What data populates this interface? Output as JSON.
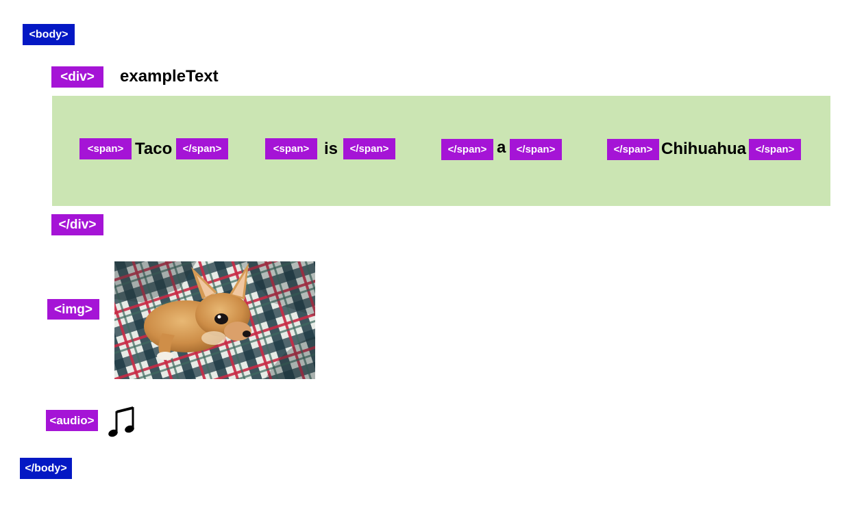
{
  "tags": {
    "body_open": "<body>",
    "div_open": "<div>",
    "div_close": "</div>",
    "img_open": "<img>",
    "audio_open": "<audio>",
    "body_close": "</body>"
  },
  "div_label": "exampleText",
  "spans": [
    {
      "open": "<span>",
      "word": "Taco",
      "close": "</span>"
    },
    {
      "open": "<span>",
      "word": "is",
      "close": "</span>"
    },
    {
      "open": "</span>",
      "word": "a",
      "close": "</span>"
    },
    {
      "open": "</span>",
      "word": "Chihuahua",
      "close": "</span>"
    }
  ],
  "colors": {
    "body_tag": "#0418c4",
    "element_tag": "#a514d6",
    "span_container": "#cbe5b3",
    "text": "#000000"
  },
  "icons": {
    "audio": "music-note-icon",
    "image": "chihuahua-photo"
  }
}
